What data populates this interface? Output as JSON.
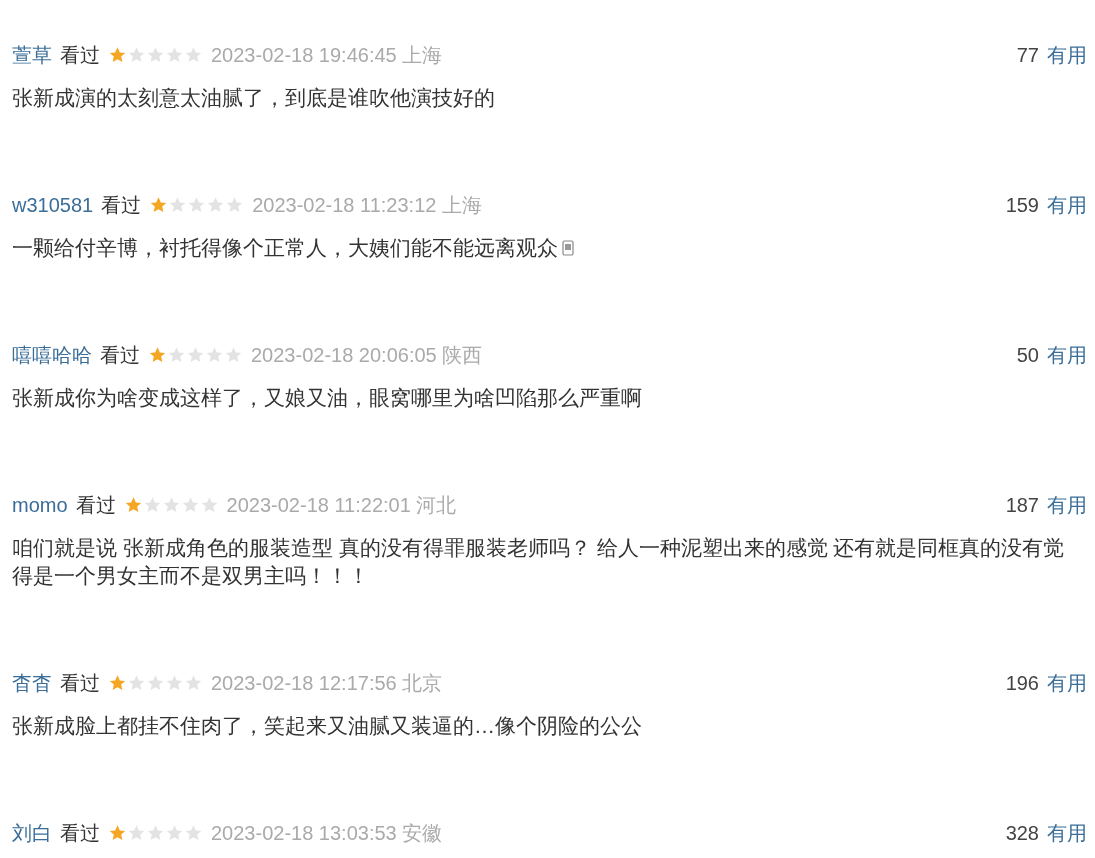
{
  "reviews": [
    {
      "user": "萱草",
      "status": "看过",
      "stars": 1,
      "time": "2023-02-18 19:46:45",
      "location": "上海",
      "votes": "77",
      "vote_label": "有用",
      "comment": "张新成演的太刻意太油腻了，到底是谁吹他演技好的",
      "has_icon": false
    },
    {
      "user": "w310581",
      "status": "看过",
      "stars": 1,
      "time": "2023-02-18 11:23:12",
      "location": "上海",
      "votes": "159",
      "vote_label": "有用",
      "comment": "一颗给付辛博，衬托得像个正常人，大姨们能不能远离观众",
      "has_icon": true
    },
    {
      "user": "嘻嘻哈哈",
      "status": "看过",
      "stars": 1,
      "time": "2023-02-18 20:06:05",
      "location": "陕西",
      "votes": "50",
      "vote_label": "有用",
      "comment": "张新成你为啥变成这样了，又娘又油，眼窝哪里为啥凹陷那么严重啊",
      "has_icon": false
    },
    {
      "user": "momo",
      "status": "看过",
      "stars": 1,
      "time": "2023-02-18 11:22:01",
      "location": "河北",
      "votes": "187",
      "vote_label": "有用",
      "comment": "咱们就是说 张新成角色的服装造型 真的没有得罪服装老师吗？ 给人一种泥塑出来的感觉 还有就是同框真的没有觉得是一个男女主而不是双男主吗！！！",
      "has_icon": false
    },
    {
      "user": "杳杳",
      "status": "看过",
      "stars": 1,
      "time": "2023-02-18 12:17:56",
      "location": "北京",
      "votes": "196",
      "vote_label": "有用",
      "comment": "张新成脸上都挂不住肉了，笑起来又油腻又装逼的…像个阴险的公公",
      "has_icon": false
    },
    {
      "user": "刘白",
      "status": "看过",
      "stars": 1,
      "time": "2023-02-18 13:03:53",
      "location": "安徽",
      "votes": "328",
      "vote_label": "有用"
    }
  ]
}
